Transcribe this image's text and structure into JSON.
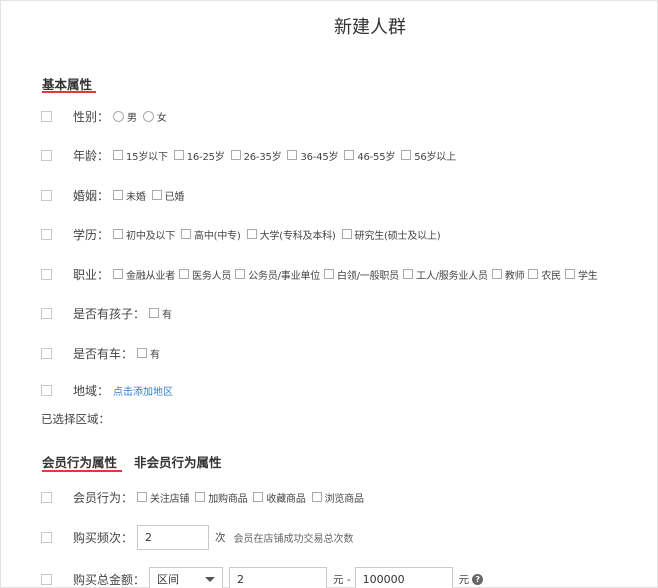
{
  "title": "新建人群",
  "basic": {
    "heading": "基本属性",
    "gender": {
      "label": "性别：",
      "options": [
        "男",
        "女"
      ]
    },
    "age": {
      "label": "年龄：",
      "options": [
        "15岁以下",
        "16-25岁",
        "26-35岁",
        "36-45岁",
        "46-55岁",
        "56岁以上"
      ]
    },
    "marriage": {
      "label": "婚姻：",
      "options": [
        "未婚",
        "已婚"
      ]
    },
    "education": {
      "label": "学历：",
      "options": [
        "初中及以下",
        "高中(中专)",
        "大学(专科及本科)",
        "研究生(硕士及以上)"
      ]
    },
    "job": {
      "label": "职业：",
      "options": [
        "金融从业者",
        "医务人员",
        "公务员/事业单位",
        "白领/一般职员",
        "工人/服务业人员",
        "教师",
        "农民",
        "学生"
      ]
    },
    "children": {
      "label": "是否有孩子：",
      "options": [
        "有"
      ]
    },
    "car": {
      "label": "是否有车：",
      "options": [
        "有"
      ]
    },
    "region": {
      "label": "地域：",
      "link": "点击添加地区"
    },
    "selected_region": "已选择区域："
  },
  "tabs": {
    "member": "会员行为属性",
    "nonmember": "非会员行为属性"
  },
  "behavior": {
    "member_action": {
      "label": "会员行为：",
      "options": [
        "关注店铺",
        "加购商品",
        "收藏商品",
        "浏览商品"
      ]
    },
    "freq": {
      "label": "购买频次：",
      "value": "2",
      "unit": "次",
      "hint": "会员在店铺成功交易总次数"
    },
    "total": {
      "label": "购买总金额：",
      "select": "区间",
      "min": "2",
      "sep": "元 -",
      "max": "100000",
      "unit": "元",
      "help": "?"
    }
  },
  "colors": {
    "accent": "#e4393c",
    "link": "#2a7fd4"
  }
}
